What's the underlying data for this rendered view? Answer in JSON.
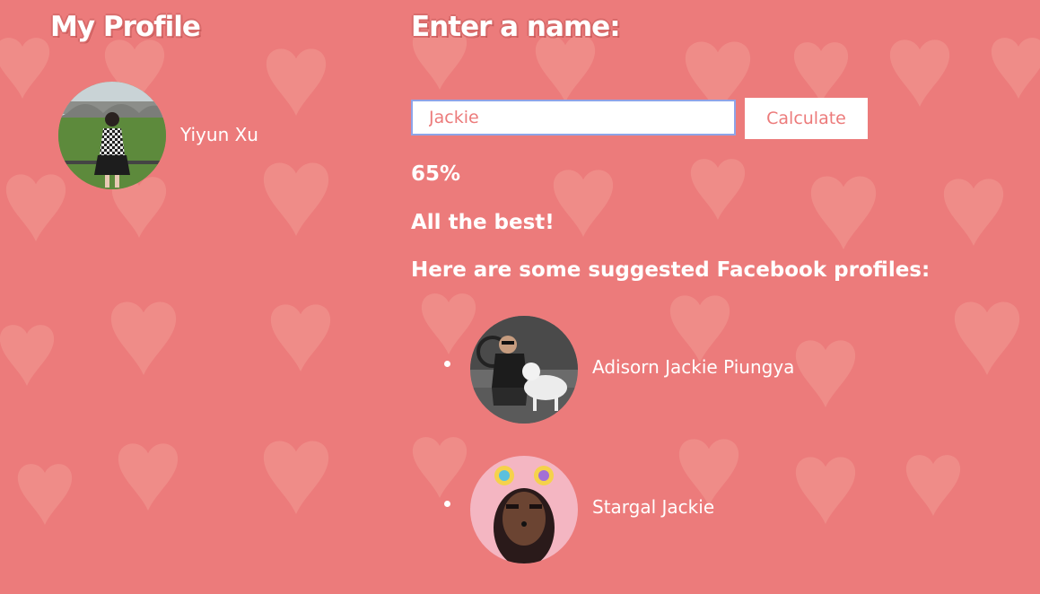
{
  "my_profile": {
    "title": "My Profile",
    "name": "Yiyun Xu",
    "avatar_icon": "profile-photo"
  },
  "matcher": {
    "title": "Enter a name:",
    "input_value": "Jackie",
    "calculate_label": "Calculate",
    "result_percent": "65%",
    "result_message": "All the best!",
    "suggest_heading": "Here are some suggested Facebook profiles:"
  },
  "suggestions": [
    {
      "name": "Adisorn Jackie Piungya",
      "avatar_icon": "profile-photo"
    },
    {
      "name": "Stargal Jackie",
      "avatar_icon": "profile-photo"
    }
  ],
  "colors": {
    "background": "#ec7b7b",
    "accent": "#ec7b7b",
    "input_border": "#8ea4e8"
  }
}
